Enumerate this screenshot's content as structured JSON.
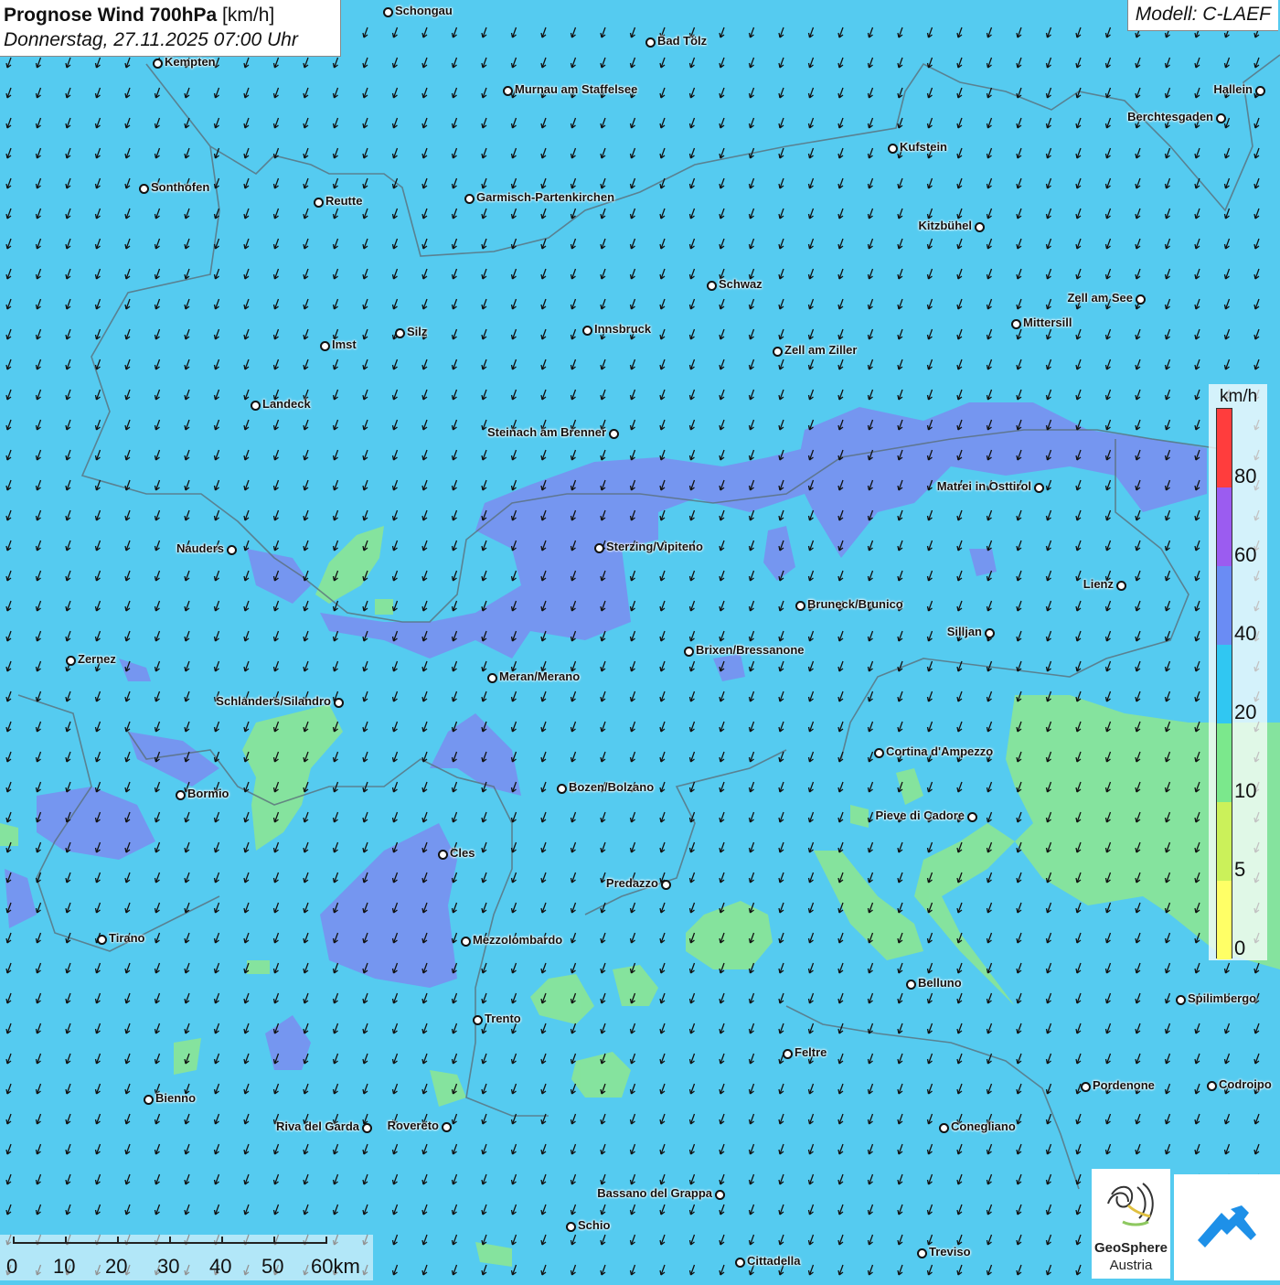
{
  "header": {
    "title": "Prognose Wind 700hPa",
    "unit": "[km/h]",
    "datetime": "Donnerstag, 27.11.2025 07:00 Uhr",
    "model": "Modell: C-LAEF"
  },
  "legend": {
    "unit": "km/h",
    "ticks": [
      "80",
      "60",
      "40",
      "20",
      "10",
      "5",
      "0"
    ],
    "colors": [
      "#ff3d3d",
      "#9b5cf0",
      "#6a8cf4",
      "#30c7f2",
      "#7be88c",
      "#cbf15a",
      "#ffff66"
    ]
  },
  "cities": [
    {
      "name": "Schongau"
    },
    {
      "name": "Bad Tölz"
    },
    {
      "name": "Kempten"
    },
    {
      "name": "Murnau am Staffelsee"
    },
    {
      "name": "Hallein"
    },
    {
      "name": "Berchtesgaden"
    },
    {
      "name": "Kufstein"
    },
    {
      "name": "Sonthofen"
    },
    {
      "name": "Reutte"
    },
    {
      "name": "Garmisch-Partenkirchen"
    },
    {
      "name": "Kitzbühel"
    },
    {
      "name": "Schwaz"
    },
    {
      "name": "Zell am See"
    },
    {
      "name": "Mittersill"
    },
    {
      "name": "Innsbruck"
    },
    {
      "name": "Silz"
    },
    {
      "name": "Imst"
    },
    {
      "name": "Zell am Ziller"
    },
    {
      "name": "Landeck"
    },
    {
      "name": "Steinach am Brenner"
    },
    {
      "name": "Matrei in Osttirol"
    },
    {
      "name": "Nauders"
    },
    {
      "name": "Sterzing/Vipiteno"
    },
    {
      "name": "Lienz"
    },
    {
      "name": "Bruneck/Brunico"
    },
    {
      "name": "Silljan"
    },
    {
      "name": "Brixen/Bressanone"
    },
    {
      "name": "Zernez"
    },
    {
      "name": "Meran/Merano"
    },
    {
      "name": "Schlanders/Silandro"
    },
    {
      "name": "Cortina d'Ampezzo"
    },
    {
      "name": "Bozen/Bolzano"
    },
    {
      "name": "Bormio"
    },
    {
      "name": "Pieve di Cadore"
    },
    {
      "name": "Cles"
    },
    {
      "name": "Predazzo"
    },
    {
      "name": "Tirano"
    },
    {
      "name": "Mezzolombardo"
    },
    {
      "name": "Belluno"
    },
    {
      "name": "Spilimbergo"
    },
    {
      "name": "Trento"
    },
    {
      "name": "Feltre"
    },
    {
      "name": "Pordenone"
    },
    {
      "name": "Codroipo"
    },
    {
      "name": "Bienno"
    },
    {
      "name": "Riva del Garda"
    },
    {
      "name": "Rovereto"
    },
    {
      "name": "Conegliano"
    },
    {
      "name": "Bassano del Grappa"
    },
    {
      "name": "Schio"
    },
    {
      "name": "Treviso"
    },
    {
      "name": "Cittadella"
    }
  ],
  "scalebar": {
    "labels": [
      "0",
      "10",
      "20",
      "30",
      "40",
      "50",
      "60km"
    ]
  },
  "logos": {
    "geosphere_line1": "GeoSphere",
    "geosphere_line2": "Austria"
  }
}
